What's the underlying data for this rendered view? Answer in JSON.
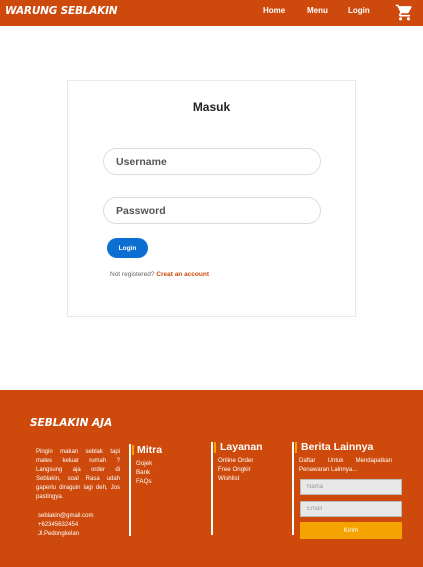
{
  "navbar": {
    "brand": "WARUNG SEBLAKIN",
    "links": [
      "Home",
      "Menu",
      "Login"
    ],
    "cart_icon": "shopping-cart-icon",
    "background": "#cd4a0c"
  },
  "login": {
    "title": "Masuk",
    "username_placeholder": "Username",
    "password_placeholder": "Password",
    "submit_label": "Login",
    "register_prompt": "Not registered?",
    "register_link": "Creat an account",
    "button_color": "#0d6fd1"
  },
  "footer": {
    "brand": "SEBLAKIN AJA",
    "about": "Pingin makan seblak tapi males keluar rumah ? Langsung aja order di Seblakin, soal Rasa udah gaperlu diraguin lagi deh, Jos pastingya.",
    "contact": {
      "email": "seblakin@gmail.com",
      "phone": "+62345632454",
      "address": "Jl.Pedongkelan"
    },
    "columns": [
      {
        "title": "Mitra",
        "items": [
          "Gojek",
          "Bank",
          "FAQs"
        ]
      },
      {
        "title": "Layanan",
        "items": [
          "Online Order",
          "Free Ongkir",
          "Wishlist"
        ]
      }
    ],
    "news": {
      "title": "Berita Lainnya",
      "text": "Daftar Untuk Mendapatkan Penawaran Lainnya...",
      "name_placeholder": "Nama",
      "email_placeholder": "Email",
      "submit_label": "Kirim"
    },
    "accent": "#f5a300"
  }
}
